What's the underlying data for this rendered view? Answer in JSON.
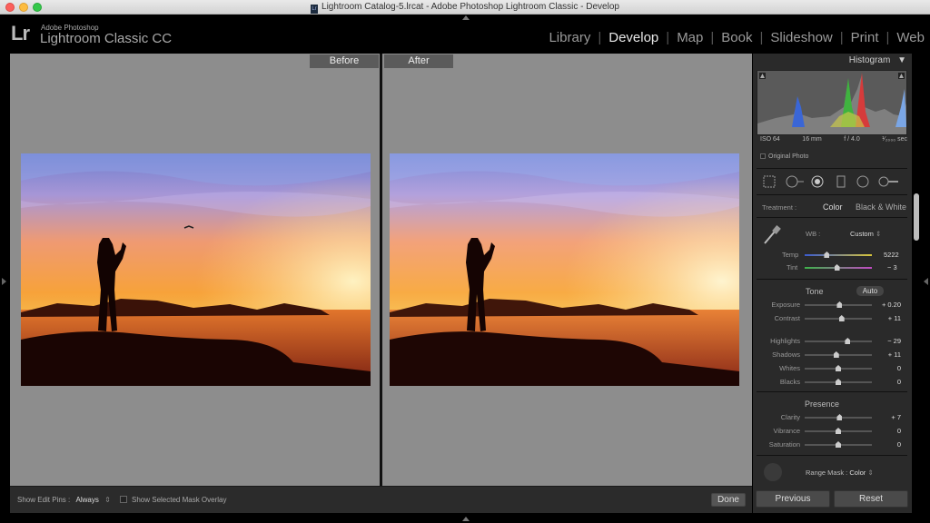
{
  "window": {
    "title": "Lightroom Catalog-5.lrcat - Adobe Photoshop Lightroom Classic - Develop",
    "doc_icon": "Lr"
  },
  "brand": {
    "logo": "Lr",
    "small": "Adobe Photoshop",
    "big": "Lightroom Classic CC"
  },
  "modules": [
    "Library",
    "Develop",
    "Map",
    "Book",
    "Slideshow",
    "Print",
    "Web"
  ],
  "active_module": "Develop",
  "compare": {
    "before_label": "Before",
    "after_label": "After"
  },
  "toolbar": {
    "edit_pins_label": "Show Edit Pins :",
    "edit_pins_value": "Always",
    "mask_overlay_label": "Show Selected Mask Overlay",
    "done_label": "Done"
  },
  "histogram": {
    "title": "Histogram",
    "iso": "ISO 64",
    "focal": "16 mm",
    "aperture": "f / 4.0",
    "shutter": "¹⁄₂₀₀₀ sec",
    "original_photo": "Original Photo"
  },
  "treatment": {
    "label": "Treatment :",
    "color": "Color",
    "bw": "Black & White"
  },
  "wb": {
    "label": "WB :",
    "value": "Custom",
    "temp_label": "Temp",
    "temp_value": "5222",
    "temp_pos": 0.33,
    "tint_label": "Tint",
    "tint_value": "− 3",
    "tint_pos": 0.48
  },
  "tone": {
    "header": "Tone",
    "auto": "Auto",
    "sliders": [
      {
        "label": "Exposure",
        "value": "+ 0.20",
        "pos": 0.52
      },
      {
        "label": "Contrast",
        "value": "+ 11",
        "pos": 0.55
      },
      {
        "label": "Highlights",
        "value": "− 29",
        "pos": 0.64
      },
      {
        "label": "Shadows",
        "value": "+ 11",
        "pos": 0.47
      },
      {
        "label": "Whites",
        "value": "0",
        "pos": 0.5
      },
      {
        "label": "Blacks",
        "value": "0",
        "pos": 0.5
      }
    ]
  },
  "presence": {
    "header": "Presence",
    "sliders": [
      {
        "label": "Clarity",
        "value": "+ 7",
        "pos": 0.52
      },
      {
        "label": "Vibrance",
        "value": "0",
        "pos": 0.5
      },
      {
        "label": "Saturation",
        "value": "0",
        "pos": 0.5
      }
    ]
  },
  "range_mask": {
    "label": "Range Mask :",
    "value": "Color"
  },
  "buttons": {
    "previous": "Previous",
    "reset": "Reset"
  }
}
